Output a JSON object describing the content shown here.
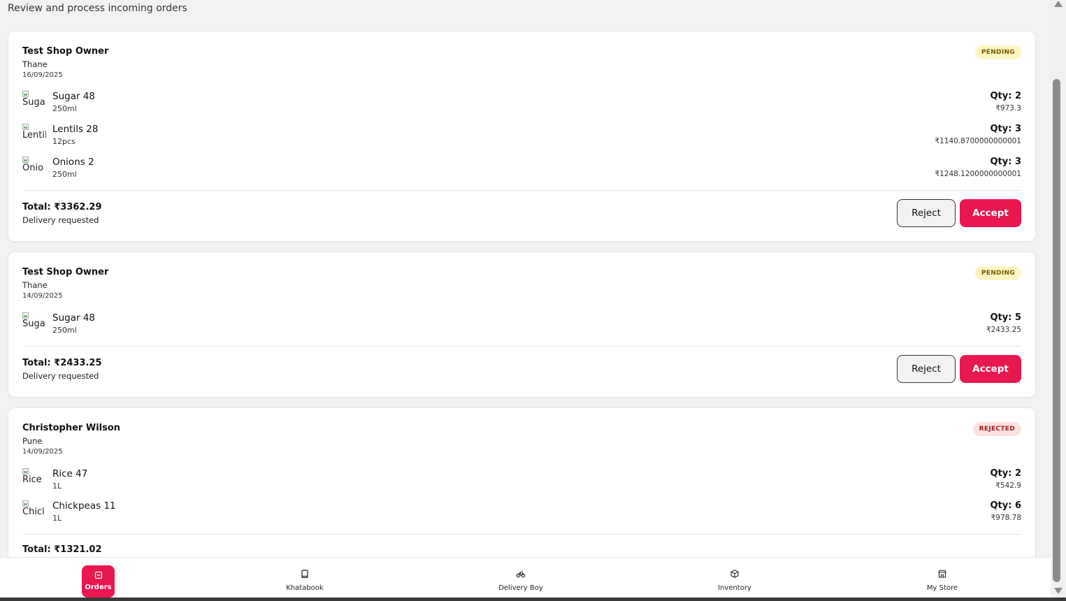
{
  "page": {
    "subtitle": "Review and process incoming orders"
  },
  "orders": [
    {
      "customer": "Test Shop Owner",
      "city": "Thane",
      "date": "16/09/2025",
      "status": "PENDING",
      "items": [
        {
          "alt": "Suga",
          "name": "Sugar 48",
          "unit": "250ml",
          "qty": "Qty: 2",
          "price": "₹973.3"
        },
        {
          "alt": "Lentil",
          "name": "Lentils 28",
          "unit": "12pcs",
          "qty": "Qty: 3",
          "price": "₹1140.8700000000001"
        },
        {
          "alt": "Onio",
          "name": "Onions 2",
          "unit": "250ml",
          "qty": "Qty: 3",
          "price": "₹1248.1200000000001"
        }
      ],
      "total": "Total: ₹3362.29",
      "delivery": "Delivery requested",
      "reject_label": "Reject",
      "accept_label": "Accept"
    },
    {
      "customer": "Test Shop Owner",
      "city": "Thane",
      "date": "14/09/2025",
      "status": "PENDING",
      "items": [
        {
          "alt": "Suga",
          "name": "Sugar 48",
          "unit": "250ml",
          "qty": "Qty: 5",
          "price": "₹2433.25"
        }
      ],
      "total": "Total: ₹2433.25",
      "delivery": "Delivery requested",
      "reject_label": "Reject",
      "accept_label": "Accept"
    },
    {
      "customer": "Christopher Wilson",
      "city": "Pune",
      "date": "14/09/2025",
      "status": "REJECTED",
      "items": [
        {
          "alt": "Rice",
          "name": "Rice 47",
          "unit": "1L",
          "qty": "Qty: 2",
          "price": "₹542.9"
        },
        {
          "alt": "Chicl",
          "name": "Chickpeas 11",
          "unit": "1L",
          "qty": "Qty: 6",
          "price": "₹978.78"
        }
      ],
      "total": "Total: ₹1321.02"
    }
  ],
  "nav": {
    "items": [
      {
        "label": "Orders",
        "icon": "bag-icon",
        "active": true
      },
      {
        "label": "Khatabook",
        "icon": "book-icon",
        "active": false
      },
      {
        "label": "Delivery Boy",
        "icon": "bike-icon",
        "active": false
      },
      {
        "label": "Inventory",
        "icon": "box-icon",
        "active": false
      },
      {
        "label": "My Store",
        "icon": "store-icon",
        "active": false
      }
    ]
  },
  "colors": {
    "accent": "#e8174f",
    "pending_bg": "#fcf6c2",
    "rejected_bg": "#fde0e0"
  }
}
